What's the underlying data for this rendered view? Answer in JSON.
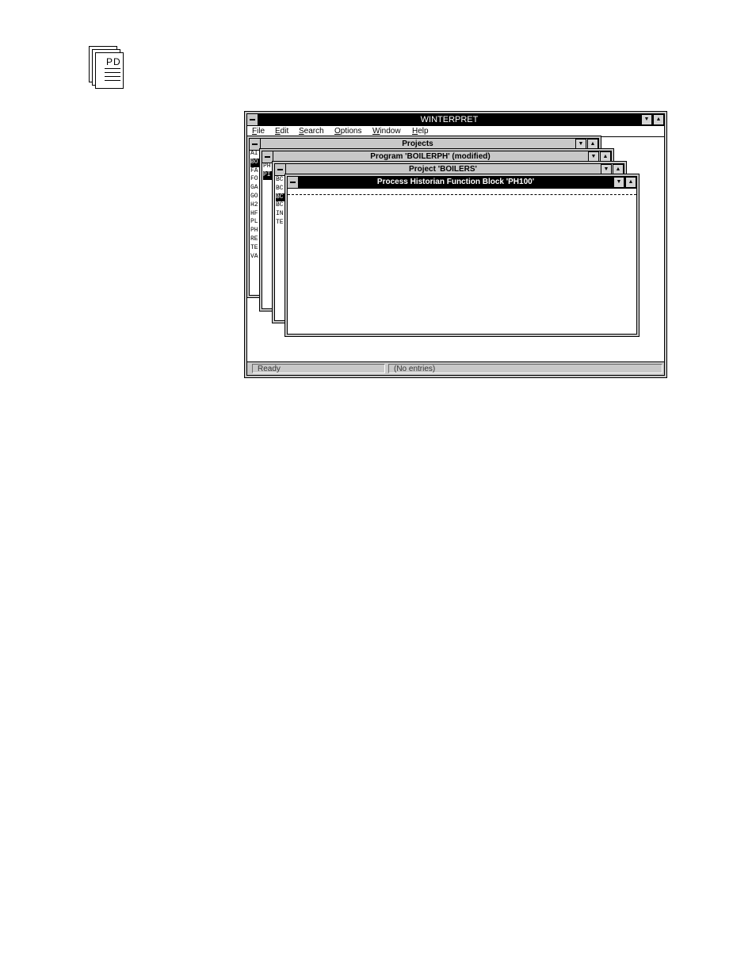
{
  "page_icon": {
    "label": "PD",
    "icon": "document-stack-icon"
  },
  "app": {
    "title": "WINTERPRET",
    "menu": [
      "File",
      "Edit",
      "Search",
      "Options",
      "Window",
      "Help"
    ],
    "status": {
      "left": "Ready",
      "right": "(No entries)"
    }
  },
  "windows": {
    "projects": {
      "title": "Projects",
      "items": [
        "AI",
        "BO",
        "FA",
        "FO",
        "GA",
        "GO",
        "H2",
        "HF",
        "PL",
        "PH",
        "RE",
        "TE",
        "VA"
      ],
      "selected_index": 1
    },
    "program": {
      "title": "Program 'BOILERPH' (modified)",
      "items": [
        "PH",
        "PI"
      ],
      "selected_index": 1
    },
    "project": {
      "title": "Project 'BOILERS'",
      "items": [
        "BC",
        "BC",
        "BC",
        "BC",
        "IN",
        "TE"
      ],
      "selected_index": 2
    },
    "function_block": {
      "title": "Process Historian Function Block 'PH100'"
    }
  }
}
